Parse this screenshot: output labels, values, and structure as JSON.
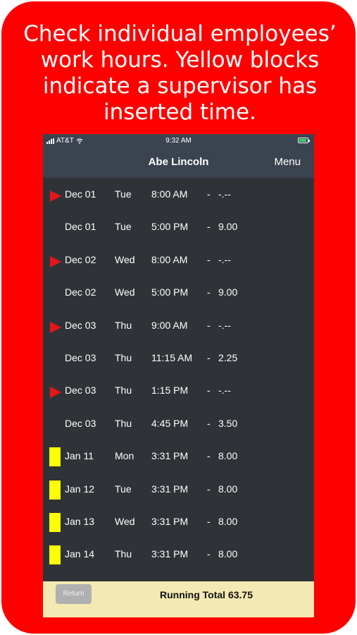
{
  "promo": {
    "headline_lines": [
      "Check individual employees’",
      "work hours. Yellow blocks",
      "indicate a supervisor has",
      "inserted time."
    ]
  },
  "statusbar": {
    "carrier": "AT&T",
    "time": "9:32 AM"
  },
  "navbar": {
    "title": "Abe Lincoln",
    "menu_label": "Menu"
  },
  "entries": [
    {
      "marker": "arrow",
      "date": "Dec 01",
      "day": "Tue",
      "time": "8:00 AM",
      "dash": "-",
      "hours": "-.--"
    },
    {
      "marker": "none",
      "date": "Dec 01",
      "day": "Tue",
      "time": "5:00 PM",
      "dash": "-",
      "hours": "9.00"
    },
    {
      "marker": "arrow",
      "date": "Dec 02",
      "day": "Wed",
      "time": "8:00 AM",
      "dash": "-",
      "hours": "-.--"
    },
    {
      "marker": "none",
      "date": "Dec 02",
      "day": "Wed",
      "time": "5:00 PM",
      "dash": "-",
      "hours": "9.00"
    },
    {
      "marker": "arrow",
      "date": "Dec 03",
      "day": "Thu",
      "time": "9:00 AM",
      "dash": "-",
      "hours": "-.--"
    },
    {
      "marker": "none",
      "date": "Dec 03",
      "day": "Thu",
      "time": "11:15 AM",
      "dash": "-",
      "hours": "2.25"
    },
    {
      "marker": "arrow",
      "date": "Dec 03",
      "day": "Thu",
      "time": "1:15 PM",
      "dash": "-",
      "hours": "-.--"
    },
    {
      "marker": "none",
      "date": "Dec 03",
      "day": "Thu",
      "time": "4:45 PM",
      "dash": "-",
      "hours": "3.50"
    },
    {
      "marker": "yellow",
      "date": "Jan 11",
      "day": "Mon",
      "time": "3:31 PM",
      "dash": "-",
      "hours": "8.00"
    },
    {
      "marker": "yellow",
      "date": "Jan 12",
      "day": "Tue",
      "time": "3:31 PM",
      "dash": "-",
      "hours": "8.00"
    },
    {
      "marker": "yellow",
      "date": "Jan 13",
      "day": "Wed",
      "time": "3:31 PM",
      "dash": "-",
      "hours": "8.00"
    },
    {
      "marker": "yellow",
      "date": "Jan 14",
      "day": "Thu",
      "time": "3:31 PM",
      "dash": "-",
      "hours": "8.00"
    }
  ],
  "footer": {
    "return_label": "Return",
    "running_total_label": "Running Total  63.75"
  },
  "icons": {
    "start_marker": "red-arrow-icon",
    "supervisor_marker": "yellow-block-icon"
  },
  "colors": {
    "promo_background": "#ff0000",
    "app_background": "#2f3338",
    "navbar": "#3b4350",
    "start_arrow": "#e8141a",
    "supervisor_block": "#ffff00",
    "footer": "#f3e9b2"
  }
}
